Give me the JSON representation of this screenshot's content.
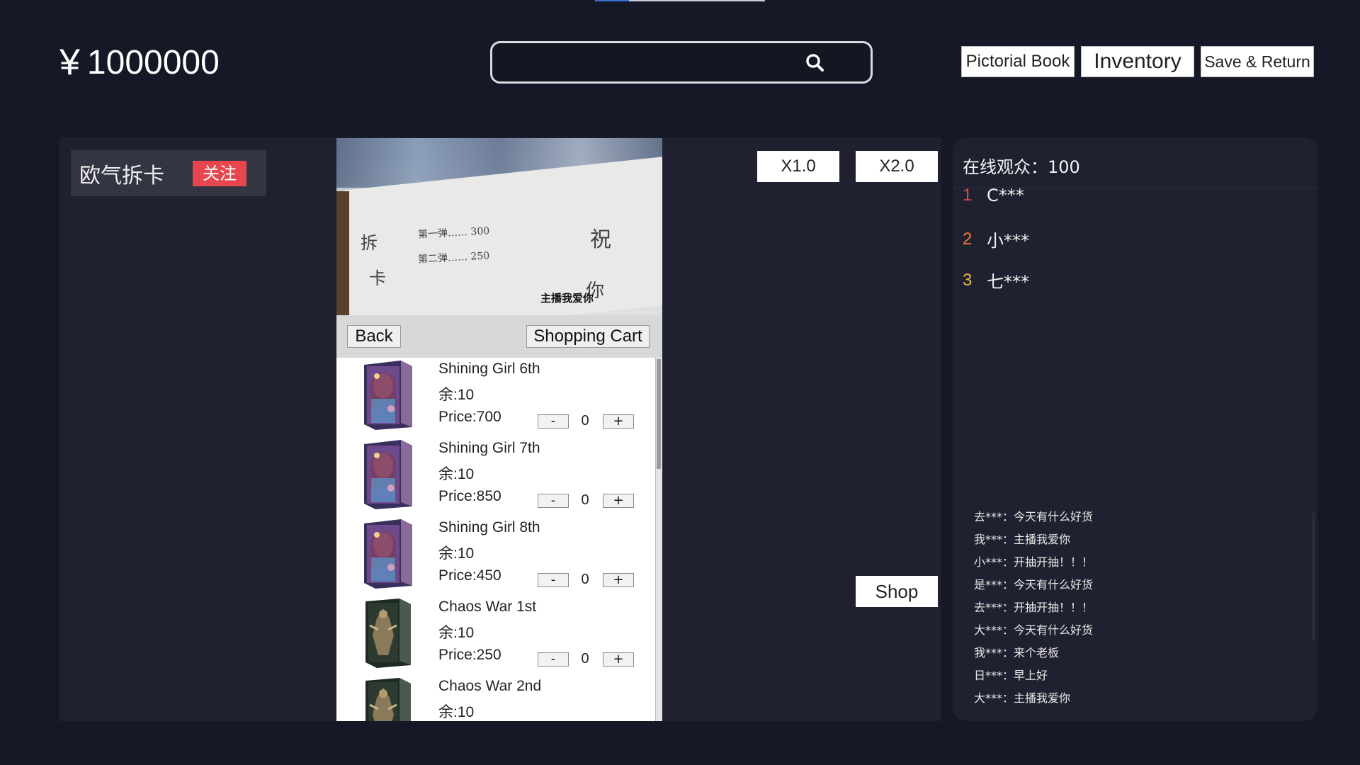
{
  "wallet": {
    "currency_symbol": "¥",
    "balance": "1000000"
  },
  "search": {
    "value": "",
    "placeholder": ""
  },
  "top_buttons": {
    "pictorial": "Pictorial Book",
    "inventory": "Inventory",
    "save": "Save & Return"
  },
  "streamer": {
    "name": "欧气拆卡",
    "follow_label": "关注"
  },
  "video": {
    "overlay_text": "主播我爱你",
    "handwriting": {
      "left1": "拆",
      "left2": "卡",
      "line1": "第一弹……  300",
      "line2": "第二弹……  250",
      "right1": "祝",
      "right2": "你"
    }
  },
  "shop": {
    "back_label": "Back",
    "cart_label": "Shopping Cart",
    "minus_label": "-",
    "plus_label": "+",
    "items": [
      {
        "name": "Shining Girl 6th",
        "stock": "余:10",
        "price": "Price:700",
        "qty": "0",
        "art": "girl"
      },
      {
        "name": "Shining Girl 7th",
        "stock": "余:10",
        "price": "Price:850",
        "qty": "0",
        "art": "girl"
      },
      {
        "name": "Shining Girl 8th",
        "stock": "余:10",
        "price": "Price:450",
        "qty": "0",
        "art": "girl"
      },
      {
        "name": "Chaos War 1st",
        "stock": "余:10",
        "price": "Price:250",
        "qty": "0",
        "art": "chaos"
      },
      {
        "name": "Chaos War 2nd",
        "stock": "余:10",
        "price": "",
        "qty": "",
        "art": "chaos"
      }
    ]
  },
  "speed": {
    "x1": "X1.0",
    "x2": "X2.0"
  },
  "shop_button": "Shop",
  "sidebar": {
    "viewers": "在线观众：100",
    "ranking": [
      {
        "rank": "1",
        "user": "C***",
        "color": "#e8464e"
      },
      {
        "rank": "2",
        "user": "小***",
        "color": "#f0783c"
      },
      {
        "rank": "3",
        "user": "七***",
        "color": "#e9b84a"
      }
    ],
    "chat": [
      "去***：今天有什么好货",
      "我***：主播我爱你",
      "小***：开抽开抽！！！",
      "是***：今天有什么好货",
      "去***：开抽开抽！！！",
      "大***：今天有什么好货",
      "我***：来个老板",
      "日***：早上好",
      "大***：主播我爱你"
    ]
  },
  "colors": {
    "background": "#151826",
    "panel": "#1f2130",
    "follow": "#e8464e"
  }
}
